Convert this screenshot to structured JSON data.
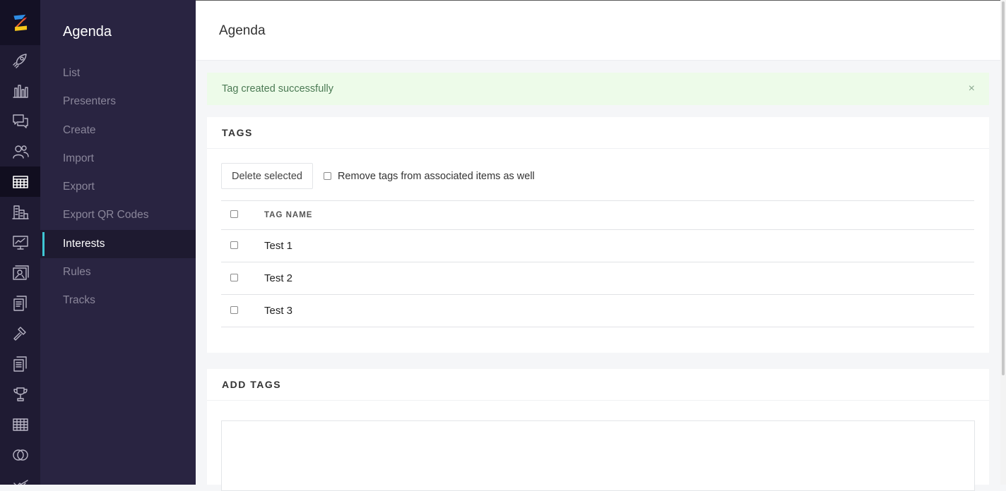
{
  "rail": {
    "icons": [
      "rocket-icon",
      "bar-chart-icon",
      "chat-bubbles-icon",
      "users-icon",
      "calendar-grid-icon",
      "buildings-icon",
      "presentation-icon",
      "map-gallery-icon",
      "documents-icon",
      "hammer-icon",
      "reports-icon",
      "trophy-icon",
      "table-icon",
      "rings-icon",
      "sponsor-icon"
    ],
    "active_index": 4
  },
  "subnav": {
    "title": "Agenda",
    "items": [
      "List",
      "Presenters",
      "Create",
      "Import",
      "Export",
      "Export QR Codes",
      "Interests",
      "Rules",
      "Tracks"
    ],
    "active": "Interests",
    "accent": "#3fc7d4"
  },
  "header": {
    "title": "Agenda"
  },
  "alert": {
    "message": "Tag created successfully",
    "close": "×"
  },
  "tags": {
    "heading": "TAGS",
    "delete_button": "Delete selected",
    "remove_checkbox_label": "Remove tags from associated items as well",
    "column_header": "TAG NAME",
    "rows": [
      "Test 1",
      "Test 2",
      "Test 3"
    ]
  },
  "add_tags": {
    "heading": "ADD TAGS"
  }
}
